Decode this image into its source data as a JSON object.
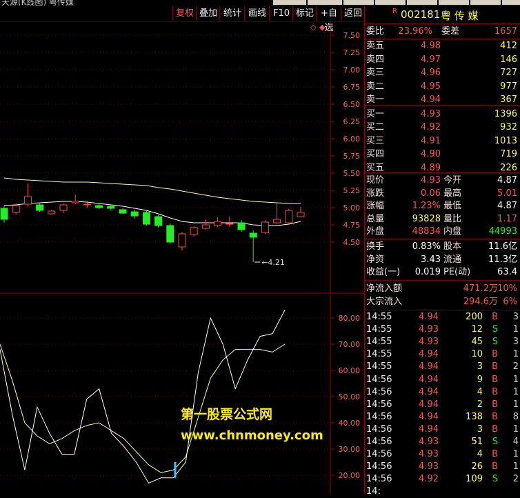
{
  "toolbar": {
    "buttons": [
      "复权",
      "叠加",
      "统计",
      "画线",
      "F10",
      "标记",
      "+自选",
      "返回"
    ],
    "active_index": 0
  },
  "stock": {
    "marker": "R",
    "code": "002181",
    "name": "粤 传 媒"
  },
  "weibi": {
    "label1": "委比",
    "v1": "23.96%",
    "label2": "委差",
    "v2": "1657"
  },
  "sell": [
    {
      "label": "卖五",
      "price": "4.98",
      "vol": "412"
    },
    {
      "label": "卖四",
      "price": "4.97",
      "vol": "146"
    },
    {
      "label": "卖三",
      "price": "4.96",
      "vol": "727"
    },
    {
      "label": "卖二",
      "price": "4.95",
      "vol": "977"
    },
    {
      "label": "卖一",
      "price": "4.94",
      "vol": "367"
    }
  ],
  "buy": [
    {
      "label": "买一",
      "price": "4.93",
      "vol": "1396"
    },
    {
      "label": "买二",
      "price": "4.92",
      "vol": "932"
    },
    {
      "label": "买三",
      "price": "4.91",
      "vol": "1013"
    },
    {
      "label": "买四",
      "price": "4.90",
      "vol": "719"
    },
    {
      "label": "买五",
      "price": "4.89",
      "vol": "226"
    }
  ],
  "stats": [
    {
      "l1": "现价",
      "v1": "4.93",
      "c1": "red",
      "l2": "今开",
      "v2": "4.87",
      "c2": "white"
    },
    {
      "l1": "涨跌",
      "v1": "0.06",
      "c1": "red",
      "l2": "最高",
      "v2": "5.01",
      "c2": "red"
    },
    {
      "l1": "涨幅",
      "v1": "1.23%",
      "c1": "red",
      "l2": "最低",
      "v2": "4.87",
      "c2": "white"
    },
    {
      "l1": "总量",
      "v1": "93828",
      "c1": "yellow",
      "l2": "量比",
      "v2": "1.17",
      "c2": "red"
    },
    {
      "l1": "外盘",
      "v1": "48834",
      "c1": "red",
      "l2": "内盘",
      "v2": "44993",
      "c2": "green"
    }
  ],
  "stats2": [
    {
      "l1": "换手",
      "v1": "0.83%",
      "l2": "股本",
      "v2": "11.6亿"
    },
    {
      "l1": "净资",
      "v1": "3.43",
      "l2": "流通",
      "v2": "11.3亿"
    },
    {
      "l1": "收益(一)",
      "v1": "0.019",
      "l2": "PE(动)",
      "v2": "63.4"
    }
  ],
  "flow": [
    {
      "label": "净流入额",
      "value": "471.2万",
      "pct": "10%"
    },
    {
      "label": "大宗流入",
      "value": "294.6万",
      "pct": "6%"
    }
  ],
  "ticks": [
    {
      "t": "14:55",
      "p": "4.94",
      "pc": "red",
      "v": "200",
      "s": "B",
      "n": "3"
    },
    {
      "t": "14:55",
      "p": "4.93",
      "pc": "red",
      "v": "12",
      "s": "S",
      "n": "1"
    },
    {
      "t": "14:55",
      "p": "4.93",
      "pc": "red",
      "v": "45",
      "s": "S",
      "n": "3"
    },
    {
      "t": "14:55",
      "p": "4.94",
      "pc": "red",
      "v": "10",
      "s": "B",
      "n": "1"
    },
    {
      "t": "14:55",
      "p": "4.94",
      "pc": "red",
      "v": "3",
      "s": "B",
      "n": "2"
    },
    {
      "t": "14:56",
      "p": "4.94",
      "pc": "red",
      "v": "9",
      "s": "B",
      "n": "1"
    },
    {
      "t": "14:56",
      "p": "4.94",
      "pc": "red",
      "v": "4",
      "s": "B",
      "n": "1"
    },
    {
      "t": "14:56",
      "p": "4.94",
      "pc": "red",
      "v": "2",
      "s": "B",
      "n": "1"
    },
    {
      "t": "14:56",
      "p": "4.94",
      "pc": "red",
      "v": "138",
      "s": "B",
      "n": "8"
    },
    {
      "t": "14:56",
      "p": "4.94",
      "pc": "red",
      "v": "3",
      "s": "B",
      "n": "1"
    },
    {
      "t": "14:56",
      "p": "4.93",
      "pc": "red",
      "v": "51",
      "s": "S",
      "n": "4"
    },
    {
      "t": "14:56",
      "p": "4.93",
      "pc": "red",
      "v": "4",
      "s": "B",
      "n": "1"
    },
    {
      "t": "14:56",
      "p": "4.93",
      "pc": "red",
      "v": "26",
      "s": "B",
      "n": "1"
    },
    {
      "t": "14:56",
      "p": "4.92",
      "pc": "red",
      "v": "109",
      "s": "S",
      "n": "2"
    },
    {
      "t": "14:",
      "p": "",
      "pc": "red",
      "v": "",
      "s": "",
      "n": ""
    }
  ],
  "chart_data": [
    {
      "type": "candlestick",
      "ylim": [
        4.25,
        7.6
      ],
      "y_ticks": [
        "7.50",
        "7.25",
        "7.00",
        "6.75",
        "6.50",
        "6.25",
        "6.00",
        "5.75",
        "5.50",
        "5.25",
        "5.00",
        "4.75",
        "4.50"
      ],
      "low_annotation": "4.21",
      "candles": [
        {
          "o": 4.99,
          "c": 4.83,
          "h": 5.02,
          "l": 4.78
        },
        {
          "o": 4.93,
          "c": 5.03,
          "h": 5.06,
          "l": 4.9
        },
        {
          "o": 5.05,
          "c": 5.16,
          "h": 5.35,
          "l": 5.02
        },
        {
          "o": 5.04,
          "c": 4.96,
          "h": 5.07,
          "l": 4.94
        },
        {
          "o": 4.91,
          "c": 4.95,
          "h": 4.97,
          "l": 4.9
        },
        {
          "o": 4.96,
          "c": 5.04,
          "h": 5.06,
          "l": 4.92
        },
        {
          "o": 5.07,
          "c": 5.09,
          "h": 5.19,
          "l": 5.05
        },
        {
          "o": 5.05,
          "c": 5.05,
          "h": 5.1,
          "l": 5.0
        },
        {
          "o": 5.03,
          "c": 5.0,
          "h": 5.05,
          "l": 4.98
        },
        {
          "o": 5.02,
          "c": 4.99,
          "h": 5.04,
          "l": 4.96
        },
        {
          "o": 4.97,
          "c": 4.92,
          "h": 4.99,
          "l": 4.91
        },
        {
          "o": 4.94,
          "c": 4.88,
          "h": 4.97,
          "l": 4.84
        },
        {
          "o": 4.93,
          "c": 4.76,
          "h": 4.95,
          "l": 4.74
        },
        {
          "o": 4.87,
          "c": 4.74,
          "h": 4.89,
          "l": 4.71
        },
        {
          "o": 4.74,
          "c": 4.5,
          "h": 4.77,
          "l": 4.48
        },
        {
          "o": 4.43,
          "c": 4.62,
          "h": 4.65,
          "l": 4.38
        },
        {
          "o": 4.61,
          "c": 4.71,
          "h": 4.73,
          "l": 4.58
        },
        {
          "o": 4.7,
          "c": 4.75,
          "h": 4.83,
          "l": 4.68
        },
        {
          "o": 4.74,
          "c": 4.8,
          "h": 4.86,
          "l": 4.72
        },
        {
          "o": 4.77,
          "c": 4.77,
          "h": 4.87,
          "l": 4.72
        },
        {
          "o": 4.78,
          "c": 4.68,
          "h": 4.82,
          "l": 4.65
        },
        {
          "o": 4.63,
          "c": 4.57,
          "h": 4.67,
          "l": 4.21
        },
        {
          "o": 4.64,
          "c": 4.79,
          "h": 4.82,
          "l": 4.62
        },
        {
          "o": 4.78,
          "c": 4.83,
          "h": 5.06,
          "l": 4.76
        },
        {
          "o": 4.78,
          "c": 4.96,
          "h": 4.98,
          "l": 4.76
        },
        {
          "o": 4.87,
          "c": 4.93,
          "h": 5.01,
          "l": 4.87
        }
      ],
      "series": [
        {
          "color": "#ffff88",
          "values": [
            5.43,
            5.41,
            5.4,
            5.39,
            5.38,
            5.37,
            5.37,
            5.37,
            5.36,
            5.35,
            5.34,
            5.33,
            5.32,
            5.29,
            5.27,
            5.24,
            5.21,
            5.18,
            5.15,
            5.13,
            5.11,
            5.09,
            5.08,
            5.07,
            5.06,
            5.06
          ]
        },
        {
          "color": "#ffffff",
          "values": [
            5.03,
            5.04,
            5.06,
            5.07,
            5.08,
            5.09,
            5.09,
            5.08,
            5.06,
            5.04,
            5.02,
            4.99,
            4.96,
            4.91,
            4.85,
            4.8,
            4.78,
            4.78,
            4.78,
            4.78,
            4.78,
            4.75,
            4.74,
            4.74,
            4.76,
            4.8
          ]
        }
      ]
    },
    {
      "type": "line",
      "ylim": [
        15,
        85
      ],
      "y_ticks": [
        "80.00",
        "70.00",
        "60.00",
        "50.00",
        "40.00",
        "30.00",
        "20.00"
      ],
      "series": [
        {
          "color": "#ffffff",
          "values": [
            68,
            43,
            22,
            46,
            36,
            28,
            28,
            49,
            53,
            36,
            31,
            25,
            17,
            19,
            19,
            25,
            59,
            80,
            70,
            53,
            64,
            73,
            74,
            83
          ]
        },
        {
          "color": "#ffff99",
          "values": [
            70,
            56,
            40,
            35,
            32,
            34,
            37,
            39,
            40,
            37,
            34,
            29,
            24,
            21,
            22,
            27,
            42,
            57,
            64,
            68,
            68,
            68,
            67,
            70
          ]
        }
      ]
    }
  ],
  "watermark": {
    "line1": "第一股票公式网",
    "line2": "www.chnmoney.com"
  }
}
